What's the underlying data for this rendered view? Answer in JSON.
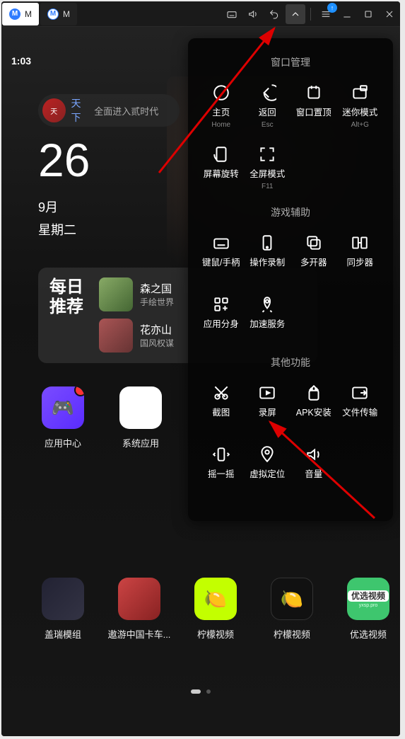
{
  "titlebar": {
    "tab1": "M",
    "tab2": "M"
  },
  "clock": "1:03",
  "search": {
    "icon_text": "天",
    "title": "天下",
    "subtitle": "全面进入贰时代"
  },
  "date": {
    "day": "26",
    "month": "9月",
    "week": "星期二"
  },
  "daily": {
    "label_line1": "每日",
    "label_line2": "推荐",
    "items": [
      {
        "name": "森之国",
        "desc": "手绘世界"
      },
      {
        "name": "花亦山",
        "desc": "国风权谋"
      }
    ]
  },
  "home_apps_row1": [
    {
      "label": "应用中心",
      "icon": "i-center",
      "glyph": "🎮",
      "badge": true
    },
    {
      "label": "系统应用",
      "icon": "i-sys"
    }
  ],
  "home_apps_row2": [
    {
      "label": "盖瑞模组",
      "icon": "i-a1"
    },
    {
      "label": "遨游中国卡车...",
      "icon": "i-a2"
    },
    {
      "label": "柠檬视频",
      "icon": "i-a3",
      "glyph": "🍋"
    },
    {
      "label": "柠檬视频",
      "icon": "i-a4",
      "glyph": "🍋"
    },
    {
      "label": "优选视频",
      "icon": "i-a5",
      "yx_badge": "优选视频",
      "yx_sub": "yxsp.pro"
    }
  ],
  "panel": {
    "section1": "窗口管理",
    "section2": "游戏辅助",
    "section3": "其他功能",
    "items1": [
      {
        "t": "主页",
        "s": "Home",
        "ic": "home"
      },
      {
        "t": "返回",
        "s": "Esc",
        "ic": "back"
      },
      {
        "t": "窗口置顶",
        "s": "",
        "ic": "pin"
      },
      {
        "t": "迷你模式",
        "s": "Alt+G",
        "ic": "mini"
      },
      {
        "t": "屏幕旋转",
        "s": "",
        "ic": "rot"
      },
      {
        "t": "全屏模式",
        "s": "F11",
        "ic": "full"
      }
    ],
    "items2": [
      {
        "t": "键鼠/手柄",
        "s": "",
        "ic": "kbd"
      },
      {
        "t": "操作录制",
        "s": "",
        "ic": "rec"
      },
      {
        "t": "多开器",
        "s": "",
        "ic": "multi"
      },
      {
        "t": "同步器",
        "s": "",
        "ic": "sync"
      },
      {
        "t": "应用分身",
        "s": "",
        "ic": "clone"
      },
      {
        "t": "加速服务",
        "s": "",
        "ic": "boost"
      }
    ],
    "items3": [
      {
        "t": "截图",
        "s": "",
        "ic": "cut"
      },
      {
        "t": "录屏",
        "s": "",
        "ic": "recscr"
      },
      {
        "t": "APK安装",
        "s": "",
        "ic": "apk"
      },
      {
        "t": "文件传输",
        "s": "",
        "ic": "xfer"
      },
      {
        "t": "摇一摇",
        "s": "",
        "ic": "shake"
      },
      {
        "t": "虚拟定位",
        "s": "",
        "ic": "loc"
      },
      {
        "t": "音量",
        "s": "",
        "ic": "vol"
      }
    ]
  }
}
